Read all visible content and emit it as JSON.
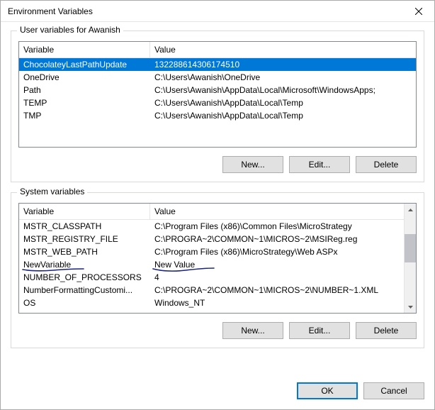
{
  "window": {
    "title": "Environment Variables"
  },
  "userSection": {
    "legend": "User variables for Awanish",
    "headers": {
      "variable": "Variable",
      "value": "Value"
    },
    "rows": [
      {
        "variable": "ChocolateyLastPathUpdate",
        "value": "132288614306174510",
        "selected": true
      },
      {
        "variable": "OneDrive",
        "value": "C:\\Users\\Awanish\\OneDrive"
      },
      {
        "variable": "Path",
        "value": "C:\\Users\\Awanish\\AppData\\Local\\Microsoft\\WindowsApps;"
      },
      {
        "variable": "TEMP",
        "value": "C:\\Users\\Awanish\\AppData\\Local\\Temp"
      },
      {
        "variable": "TMP",
        "value": "C:\\Users\\Awanish\\AppData\\Local\\Temp"
      }
    ],
    "buttons": {
      "new": "New...",
      "edit": "Edit...",
      "delete": "Delete"
    }
  },
  "systemSection": {
    "legend": "System variables",
    "headers": {
      "variable": "Variable",
      "value": "Value"
    },
    "rows": [
      {
        "variable": "MSTR_CLASSPATH",
        "value": "C:\\Program Files (x86)\\Common Files\\MicroStrategy"
      },
      {
        "variable": "MSTR_REGISTRY_FILE",
        "value": "C:\\PROGRA~2\\COMMON~1\\MICROS~2\\MSIReg.reg"
      },
      {
        "variable": "MSTR_WEB_PATH",
        "value": "C:\\Program Files (x86)\\MicroStrategy\\Web ASPx"
      },
      {
        "variable": "NewVariable",
        "value": "New Value"
      },
      {
        "variable": "NUMBER_OF_PROCESSORS",
        "value": "4"
      },
      {
        "variable": "NumberFormattingCustomi...",
        "value": "C:\\PROGRA~2\\COMMON~1\\MICROS~2\\NUMBER~1.XML"
      },
      {
        "variable": "OS",
        "value": "Windows_NT"
      }
    ],
    "buttons": {
      "new": "New...",
      "edit": "Edit...",
      "delete": "Delete"
    }
  },
  "footer": {
    "ok": "OK",
    "cancel": "Cancel"
  }
}
